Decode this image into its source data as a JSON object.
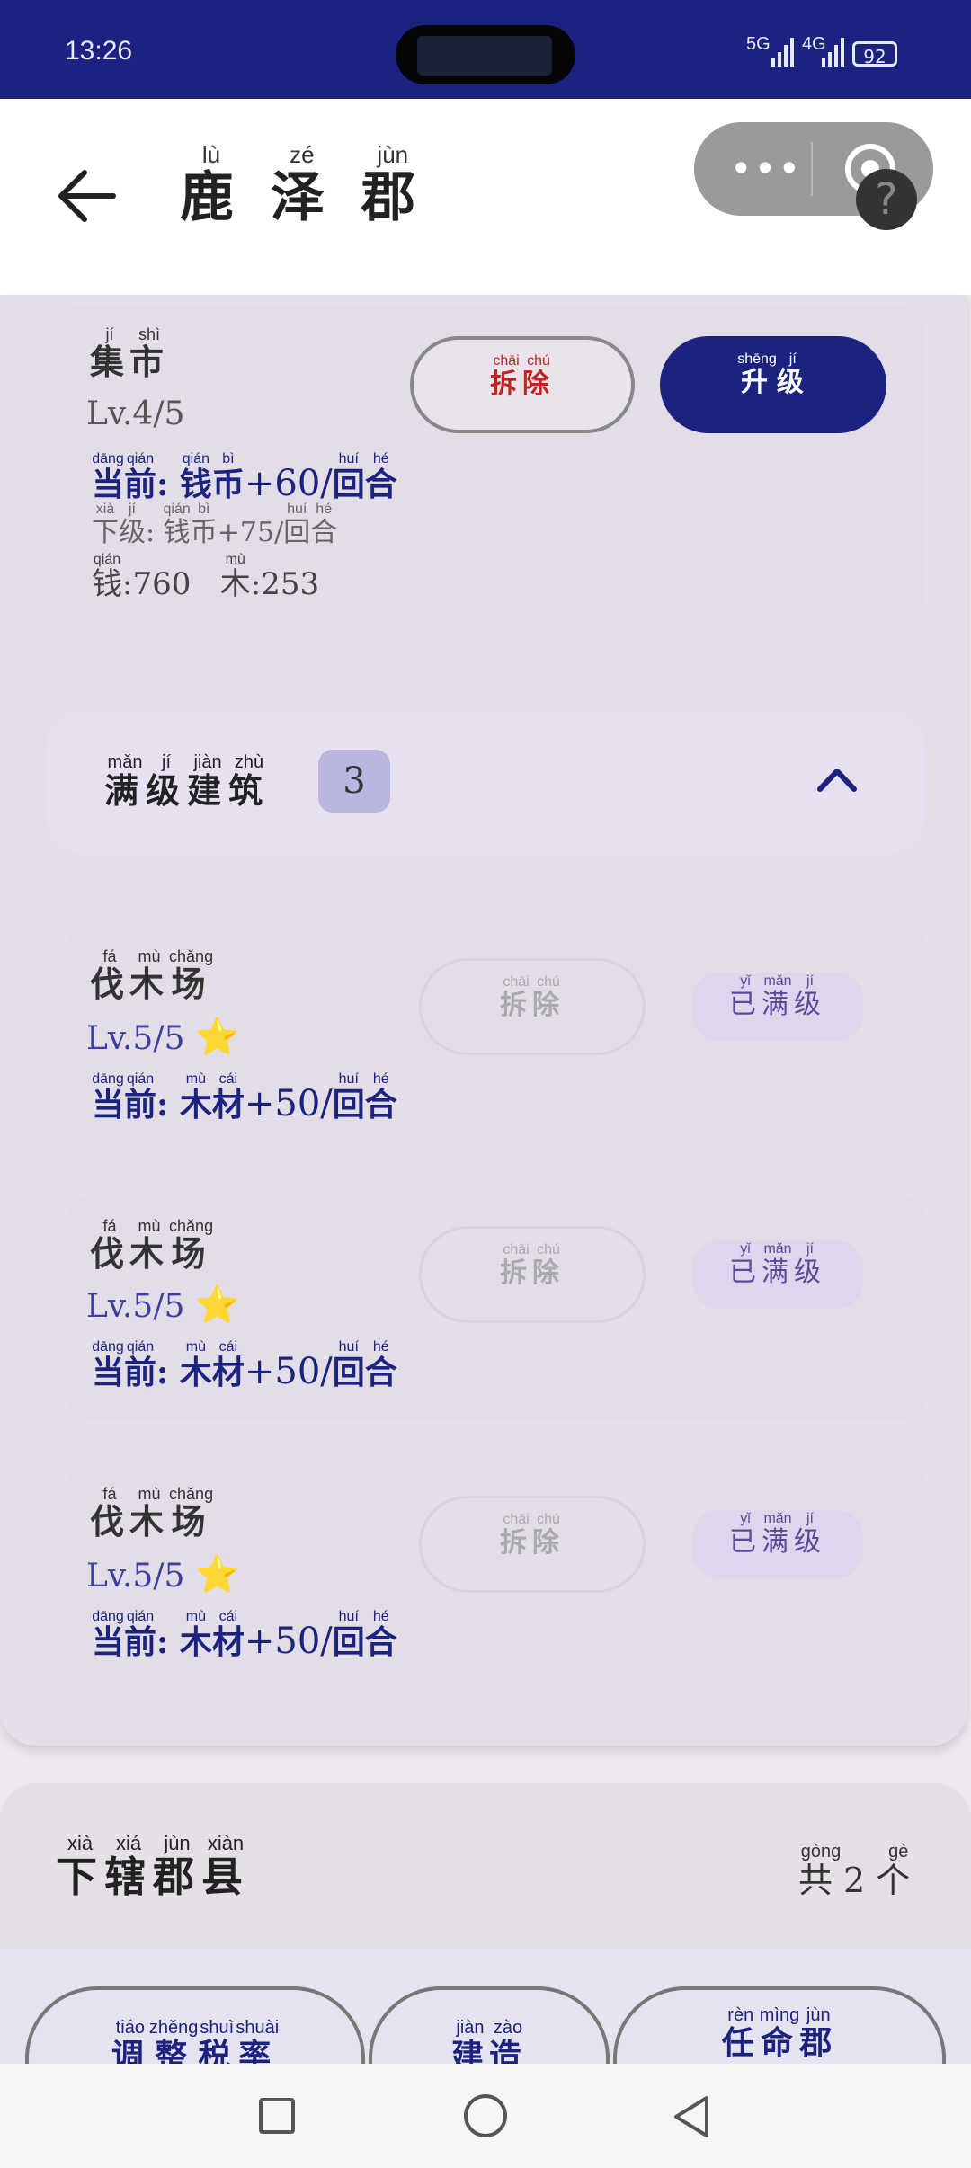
{
  "status_bar": {
    "time": "13:26",
    "signal_5g": "5G",
    "signal_4g": "4G",
    "battery": "92"
  },
  "header": {
    "back_icon": "arrow-left-icon",
    "title": [
      {
        "char": "鹿",
        "pinyin": "lù"
      },
      {
        "char": "泽",
        "pinyin": "zé"
      },
      {
        "char": "郡",
        "pinyin": "jùn"
      }
    ],
    "capsule_more": "•••",
    "help": "?"
  },
  "buildings_top": [
    {
      "name": [
        {
          "char": "集",
          "pinyin": "jí"
        },
        {
          "char": "市",
          "pinyin": "shì"
        }
      ],
      "level": "Lv.4/5",
      "demolish": [
        {
          "char": "拆",
          "pinyin": "chāi"
        },
        {
          "char": "除",
          "pinyin": "chú"
        }
      ],
      "upgrade": [
        {
          "char": "升",
          "pinyin": "shēng"
        },
        {
          "char": "级",
          "pinyin": "jí"
        }
      ],
      "current": {
        "prefix": [
          {
            "char": "当",
            "pinyin": "dāng"
          },
          {
            "char": "前",
            "pinyin": "qián"
          }
        ],
        "resource": [
          {
            "char": "钱",
            "pinyin": "qián"
          },
          {
            "char": "币",
            "pinyin": "bì"
          }
        ],
        "amount": "+60/",
        "unit": [
          {
            "char": "回",
            "pinyin": "huí"
          },
          {
            "char": "合",
            "pinyin": "hé"
          }
        ]
      },
      "next": {
        "prefix": [
          {
            "char": "下",
            "pinyin": "xià"
          },
          {
            "char": "级",
            "pinyin": "jí"
          }
        ],
        "resource": [
          {
            "char": "钱",
            "pinyin": "qián"
          },
          {
            "char": "币",
            "pinyin": "bì"
          }
        ],
        "amount": "+75/",
        "unit": [
          {
            "char": "回",
            "pinyin": "huí"
          },
          {
            "char": "合",
            "pinyin": "hé"
          }
        ]
      },
      "cost": [
        {
          "char": "钱",
          "pinyin": "qián",
          "value": ":760"
        },
        {
          "char": "木",
          "pinyin": "mù",
          "value": ":253"
        }
      ]
    }
  ],
  "maxed_section": {
    "title": [
      {
        "char": "满",
        "pinyin": "mǎn"
      },
      {
        "char": "级",
        "pinyin": "jí"
      },
      {
        "char": "建",
        "pinyin": "jiàn"
      },
      {
        "char": "筑",
        "pinyin": "zhù"
      }
    ],
    "count": "3",
    "toggle_icon": "chevron-up-icon"
  },
  "maxed_buildings": [
    {
      "name": [
        {
          "char": "伐",
          "pinyin": "fá"
        },
        {
          "char": "木",
          "pinyin": "mù"
        },
        {
          "char": "场",
          "pinyin": "chǎng"
        }
      ],
      "level": "Lv.5/5",
      "star": "⭐",
      "demolish": [
        {
          "char": "拆",
          "pinyin": "chāi"
        },
        {
          "char": "除",
          "pinyin": "chú"
        }
      ],
      "maxed": [
        {
          "char": "已",
          "pinyin": "yǐ"
        },
        {
          "char": "满",
          "pinyin": "mǎn"
        },
        {
          "char": "级",
          "pinyin": "jí"
        }
      ],
      "prefix": [
        {
          "char": "当",
          "pinyin": "dāng"
        },
        {
          "char": "前",
          "pinyin": "qián"
        }
      ],
      "resource": [
        {
          "char": "木",
          "pinyin": "mù"
        },
        {
          "char": "材",
          "pinyin": "cái"
        }
      ],
      "amount": "+50/",
      "unit": [
        {
          "char": "回",
          "pinyin": "huí"
        },
        {
          "char": "合",
          "pinyin": "hé"
        }
      ]
    },
    {
      "name": [
        {
          "char": "伐",
          "pinyin": "fá"
        },
        {
          "char": "木",
          "pinyin": "mù"
        },
        {
          "char": "场",
          "pinyin": "chǎng"
        }
      ],
      "level": "Lv.5/5",
      "star": "⭐",
      "demolish": [
        {
          "char": "拆",
          "pinyin": "chāi"
        },
        {
          "char": "除",
          "pinyin": "chú"
        }
      ],
      "maxed": [
        {
          "char": "已",
          "pinyin": "yǐ"
        },
        {
          "char": "满",
          "pinyin": "mǎn"
        },
        {
          "char": "级",
          "pinyin": "jí"
        }
      ],
      "prefix": [
        {
          "char": "当",
          "pinyin": "dāng"
        },
        {
          "char": "前",
          "pinyin": "qián"
        }
      ],
      "resource": [
        {
          "char": "木",
          "pinyin": "mù"
        },
        {
          "char": "材",
          "pinyin": "cái"
        }
      ],
      "amount": "+50/",
      "unit": [
        {
          "char": "回",
          "pinyin": "huí"
        },
        {
          "char": "合",
          "pinyin": "hé"
        }
      ]
    },
    {
      "name": [
        {
          "char": "伐",
          "pinyin": "fá"
        },
        {
          "char": "木",
          "pinyin": "mù"
        },
        {
          "char": "场",
          "pinyin": "chǎng"
        }
      ],
      "level": "Lv.5/5",
      "star": "⭐",
      "demolish": [
        {
          "char": "拆",
          "pinyin": "chāi"
        },
        {
          "char": "除",
          "pinyin": "chú"
        }
      ],
      "maxed": [
        {
          "char": "已",
          "pinyin": "yǐ"
        },
        {
          "char": "满",
          "pinyin": "mǎn"
        },
        {
          "char": "级",
          "pinyin": "jí"
        }
      ],
      "prefix": [
        {
          "char": "当",
          "pinyin": "dāng"
        },
        {
          "char": "前",
          "pinyin": "qián"
        }
      ],
      "resource": [
        {
          "char": "木",
          "pinyin": "mù"
        },
        {
          "char": "材",
          "pinyin": "cái"
        }
      ],
      "amount": "+50/",
      "unit": [
        {
          "char": "回",
          "pinyin": "huí"
        },
        {
          "char": "合",
          "pinyin": "hé"
        }
      ]
    }
  ],
  "counties_section": {
    "title": [
      {
        "char": "下",
        "pinyin": "xià"
      },
      {
        "char": "辖",
        "pinyin": "xiá"
      },
      {
        "char": "郡",
        "pinyin": "jùn"
      },
      {
        "char": "县",
        "pinyin": "xiàn"
      }
    ],
    "count_prefix": {
      "char": "共",
      "pinyin": "gòng"
    },
    "count": "2",
    "count_suffix": {
      "char": "个",
      "pinyin": "gè"
    }
  },
  "bottom_actions": [
    [
      {
        "char": "调",
        "pinyin": "tiáo"
      },
      {
        "char": "整",
        "pinyin": "zhěng"
      },
      {
        "char": "税",
        "pinyin": "shuì"
      },
      {
        "char": "率",
        "pinyin": "shuài"
      }
    ],
    [
      {
        "char": "建",
        "pinyin": "jiàn"
      },
      {
        "char": "造",
        "pinyin": "zào"
      }
    ],
    [
      {
        "char": "任",
        "pinyin": "rèn"
      },
      {
        "char": "命",
        "pinyin": "mìng"
      },
      {
        "char": "郡",
        "pinyin": "jùn"
      }
    ]
  ],
  "nav_bar": {
    "recents_icon": "square-icon",
    "home_icon": "circle-icon",
    "back_icon": "triangle-back-icon"
  },
  "colors": {
    "primary": "#1b237e",
    "danger": "#c0241e",
    "panel": "#e5dfe9",
    "star": "#f5c518"
  }
}
